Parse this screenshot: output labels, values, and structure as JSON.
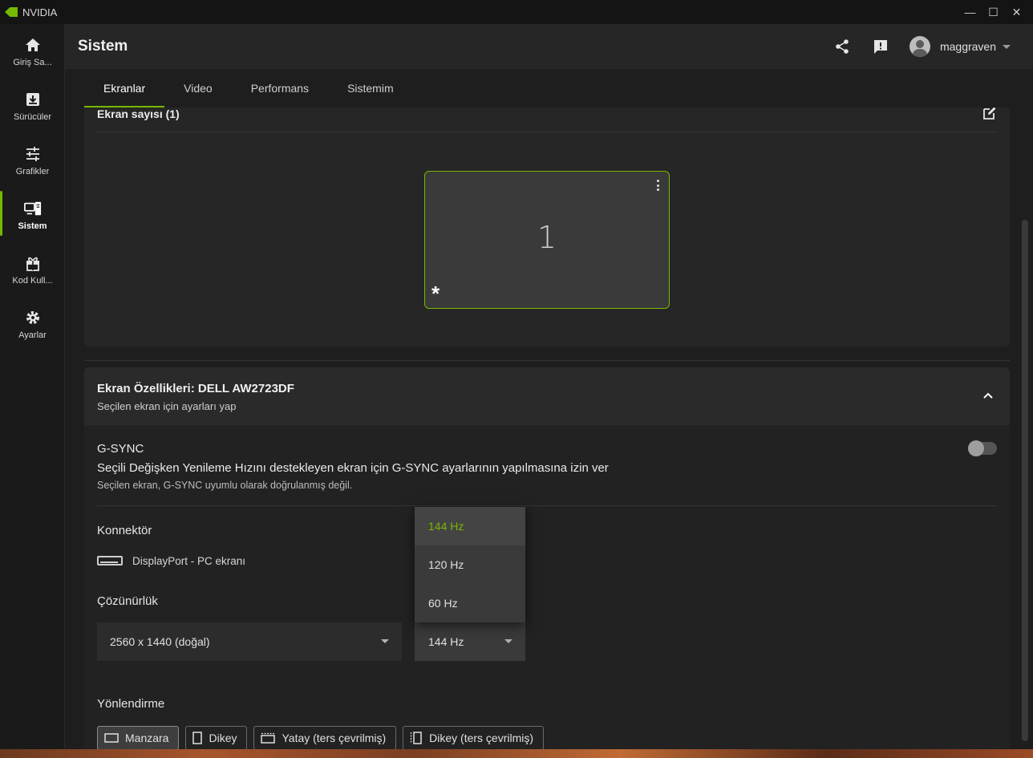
{
  "window": {
    "app_title": "NVIDIA",
    "minimize": "—",
    "maximize": "☐",
    "close": "✕"
  },
  "sidebar": {
    "items": [
      {
        "label": "Giriş Sa...",
        "icon": "home-icon"
      },
      {
        "label": "Sürücüler",
        "icon": "download-icon"
      },
      {
        "label": "Grafikler",
        "icon": "sliders-icon"
      },
      {
        "label": "Sistem",
        "icon": "system-icon",
        "active": true
      },
      {
        "label": "Kod Kull...",
        "icon": "gift-icon"
      },
      {
        "label": "Ayarlar",
        "icon": "gear-icon"
      }
    ]
  },
  "header": {
    "title": "Sistem",
    "username": "maggraven"
  },
  "tabs": [
    {
      "label": "Ekranlar",
      "active": true
    },
    {
      "label": "Video"
    },
    {
      "label": "Performans"
    },
    {
      "label": "Sistemim"
    }
  ],
  "displays": {
    "title": "Ekran sayısı (1)",
    "monitor_number": "1",
    "primary_marker": "*"
  },
  "properties": {
    "title": "Ekran Özellikleri: DELL AW2723DF",
    "subtitle": "Seçilen ekran için ayarları yap",
    "gsync": {
      "title": "G-SYNC",
      "description": "Seçili Değişken Yenileme Hızını destekleyen ekran için G-SYNC ayarlarının yapılmasına izin ver",
      "note": "Seçilen ekran, G-SYNC uyumlu olarak doğrulanmış değil.",
      "enabled": false
    },
    "connector": {
      "label": "Konnektör",
      "value": "DisplayPort - PC ekranı"
    },
    "resolution": {
      "label": "Çözünürlük",
      "value": "2560 x 1440 (doğal)",
      "refresh_value": "144 Hz"
    },
    "refresh_options": [
      "144 Hz",
      "120 Hz",
      "60 Hz"
    ],
    "orientation": {
      "label": "Yönlendirme",
      "options": [
        "Manzara",
        "Dikey",
        "Yatay (ters çevrilmiş)",
        "Dikey (ters çevrilmiş)"
      ],
      "selected": "Manzara"
    }
  },
  "colors": {
    "accent": "#76b900"
  }
}
